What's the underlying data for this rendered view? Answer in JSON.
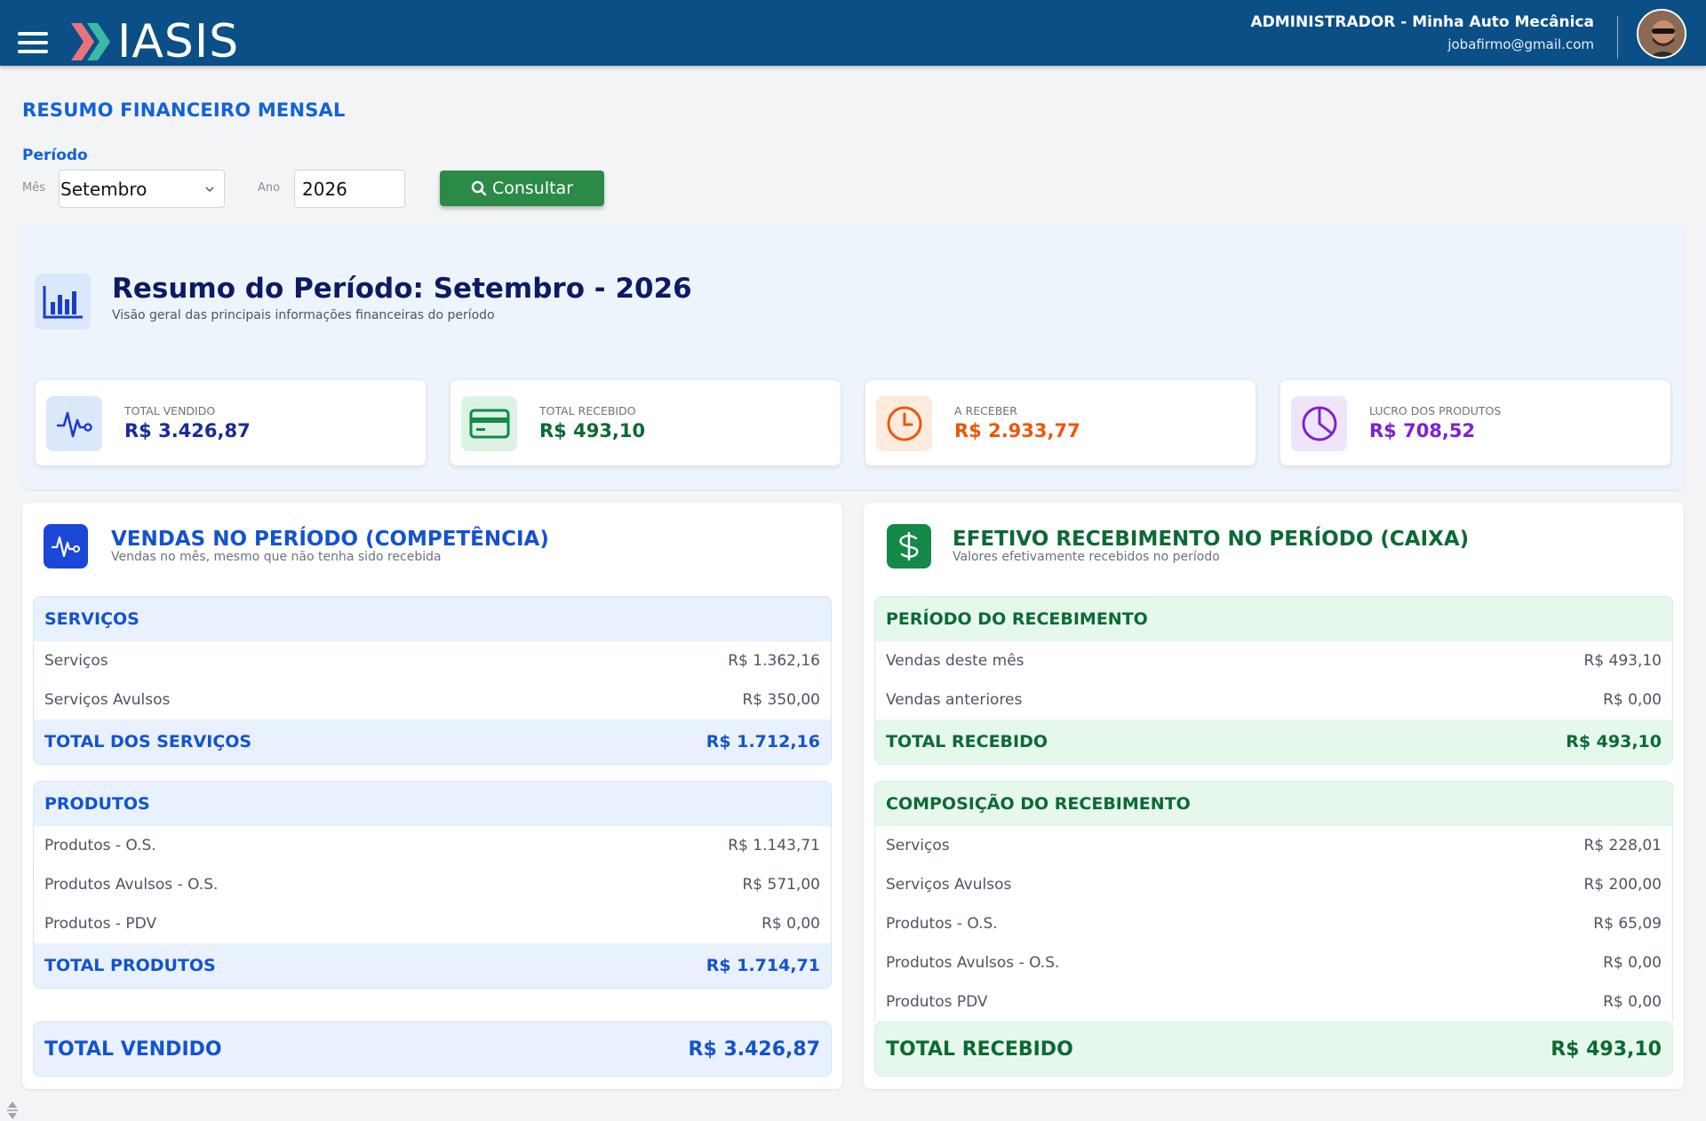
{
  "header": {
    "logo_text": "IASIS",
    "user_title": "ADMINISTRADOR - Minha Auto Mecânica",
    "user_email": "jobafirmo@gmail.com"
  },
  "page": {
    "title": "RESUMO FINANCEIRO MENSAL",
    "period_label": "Período",
    "month_label": "Mês",
    "month_value": "Setembro",
    "year_label": "Ano",
    "year_value": "2026",
    "consult_label": "Consultar"
  },
  "summary": {
    "title": "Resumo do Período: Setembro - 2026",
    "subtitle": "Visão geral das principais informações financeiras do período",
    "kpis": [
      {
        "label": "TOTAL VENDIDO",
        "value": "R$ 3.426,87",
        "color": "#1a2a9c"
      },
      {
        "label": "TOTAL RECEBIDO",
        "value": "R$ 493,10",
        "color": "#0b6a34"
      },
      {
        "label": "A RECEBER",
        "value": "R$ 2.933,77",
        "color": "#ea580c"
      },
      {
        "label": "LUCRO DOS PRODUTOS",
        "value": "R$ 708,52",
        "color": "#7e22ce"
      }
    ]
  },
  "sales": {
    "title": "VENDAS NO PERÍODO (COMPETÊNCIA)",
    "subtitle": "Vendas no mês, mesmo que não tenha sido recebida",
    "services": {
      "heading": "SERVIÇOS",
      "rows": [
        {
          "label": "Serviços",
          "value": "R$ 1.362,16"
        },
        {
          "label": "Serviços Avulsos",
          "value": "R$ 350,00"
        }
      ],
      "total_label": "TOTAL DOS SERVIÇOS",
      "total_value": "R$ 1.712,16"
    },
    "products": {
      "heading": "PRODUTOS",
      "rows": [
        {
          "label": "Produtos - O.S.",
          "value": "R$ 1.143,71"
        },
        {
          "label": "Produtos Avulsos - O.S.",
          "value": "R$ 571,00"
        },
        {
          "label": "Produtos - PDV",
          "value": "R$ 0,00"
        }
      ],
      "total_label": "TOTAL PRODUTOS",
      "total_value": "R$ 1.714,71"
    },
    "grand_label": "TOTAL VENDIDO",
    "grand_value": "R$ 3.426,87"
  },
  "receipts": {
    "title": "EFETIVO RECEBIMENTO NO PERÍODO (CAIXA)",
    "subtitle": "Valores efetivamente recebidos no período",
    "period": {
      "heading": "PERÍODO DO RECEBIMENTO",
      "rows": [
        {
          "label": "Vendas deste mês",
          "value": "R$ 493,10"
        },
        {
          "label": "Vendas anteriores",
          "value": "R$ 0,00"
        }
      ],
      "total_label": "TOTAL RECEBIDO",
      "total_value": "R$ 493,10"
    },
    "composition": {
      "heading": "COMPOSIÇÃO DO RECEBIMENTO",
      "rows": [
        {
          "label": "Serviços",
          "value": "R$ 228,01"
        },
        {
          "label": "Serviços Avulsos",
          "value": "R$ 200,00"
        },
        {
          "label": "Produtos - O.S.",
          "value": "R$ 65,09"
        },
        {
          "label": "Produtos Avulsos - O.S.",
          "value": "R$ 0,00"
        },
        {
          "label": "Produtos PDV",
          "value": "R$ 0,00"
        }
      ]
    },
    "grand_label": "TOTAL RECEBIDO",
    "grand_value": "R$ 493,10"
  },
  "colors": {
    "header_bg": "#0a4f86",
    "accent_blue": "#1362d6",
    "accent_green": "#2a8a46"
  }
}
